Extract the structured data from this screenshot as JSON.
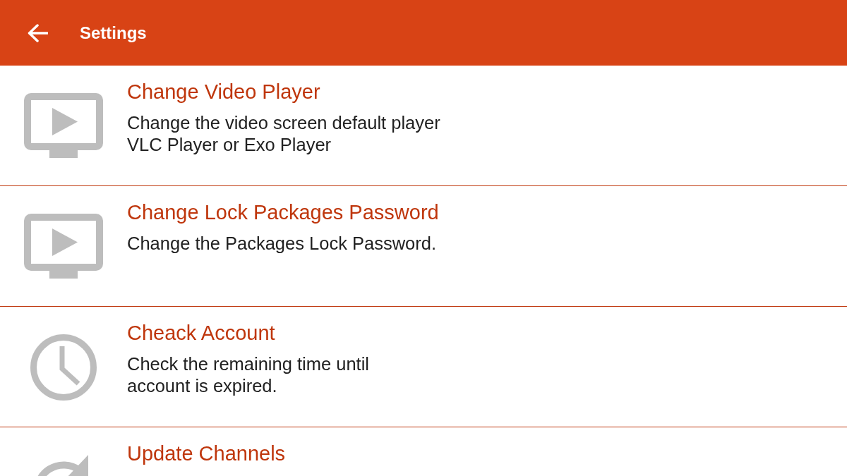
{
  "app_bar": {
    "title": "Settings"
  },
  "items": [
    {
      "kind": "player",
      "title": "Change Video Player",
      "description": [
        "Change the video screen default player",
        "VLC Player or Exo Player"
      ]
    },
    {
      "kind": "player",
      "title": "Change Lock Packages Password",
      "description": [
        "Change the Packages Lock Password."
      ]
    },
    {
      "kind": "clock",
      "title": "Cheack Account",
      "description": [
        "Check the remaining time until",
        "account is expired."
      ]
    },
    {
      "kind": "refresh",
      "title": "Update Channels"
    }
  ]
}
